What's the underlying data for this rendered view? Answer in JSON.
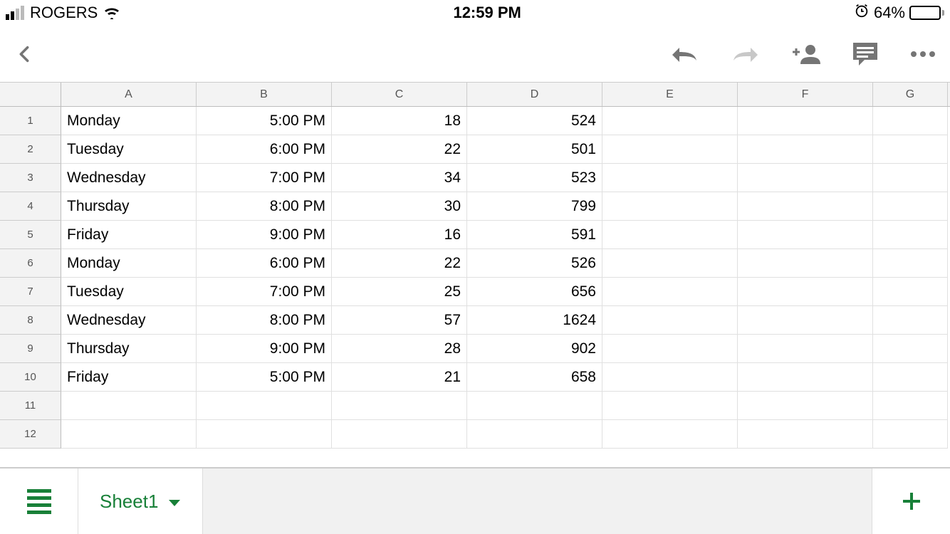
{
  "statusbar": {
    "carrier": "ROGERS",
    "time": "12:59 PM",
    "battery_pct": "64%",
    "battery_fill": 64
  },
  "columns": [
    "A",
    "B",
    "C",
    "D",
    "E",
    "F",
    "G"
  ],
  "row_numbers": [
    "1",
    "2",
    "3",
    "4",
    "5",
    "6",
    "7",
    "8",
    "9",
    "10",
    "11",
    "12"
  ],
  "rows": [
    {
      "a": "Monday",
      "b": "5:00 PM",
      "c": "18",
      "d": "524"
    },
    {
      "a": "Tuesday",
      "b": "6:00 PM",
      "c": "22",
      "d": "501"
    },
    {
      "a": "Wednesday",
      "b": "7:00 PM",
      "c": "34",
      "d": "523"
    },
    {
      "a": "Thursday",
      "b": "8:00 PM",
      "c": "30",
      "d": "799"
    },
    {
      "a": "Friday",
      "b": "9:00 PM",
      "c": "16",
      "d": "591"
    },
    {
      "a": "Monday",
      "b": "6:00 PM",
      "c": "22",
      "d": "526"
    },
    {
      "a": "Tuesday",
      "b": "7:00 PM",
      "c": "25",
      "d": "656"
    },
    {
      "a": "Wednesday",
      "b": "8:00 PM",
      "c": "57",
      "d": "1624"
    },
    {
      "a": "Thursday",
      "b": "9:00 PM",
      "c": "28",
      "d": "902"
    },
    {
      "a": "Friday",
      "b": "5:00 PM",
      "c": "21",
      "d": "658"
    },
    {
      "a": "",
      "b": "",
      "c": "",
      "d": ""
    },
    {
      "a": "",
      "b": "",
      "c": "",
      "d": ""
    }
  ],
  "sheet_tab": "Sheet1"
}
